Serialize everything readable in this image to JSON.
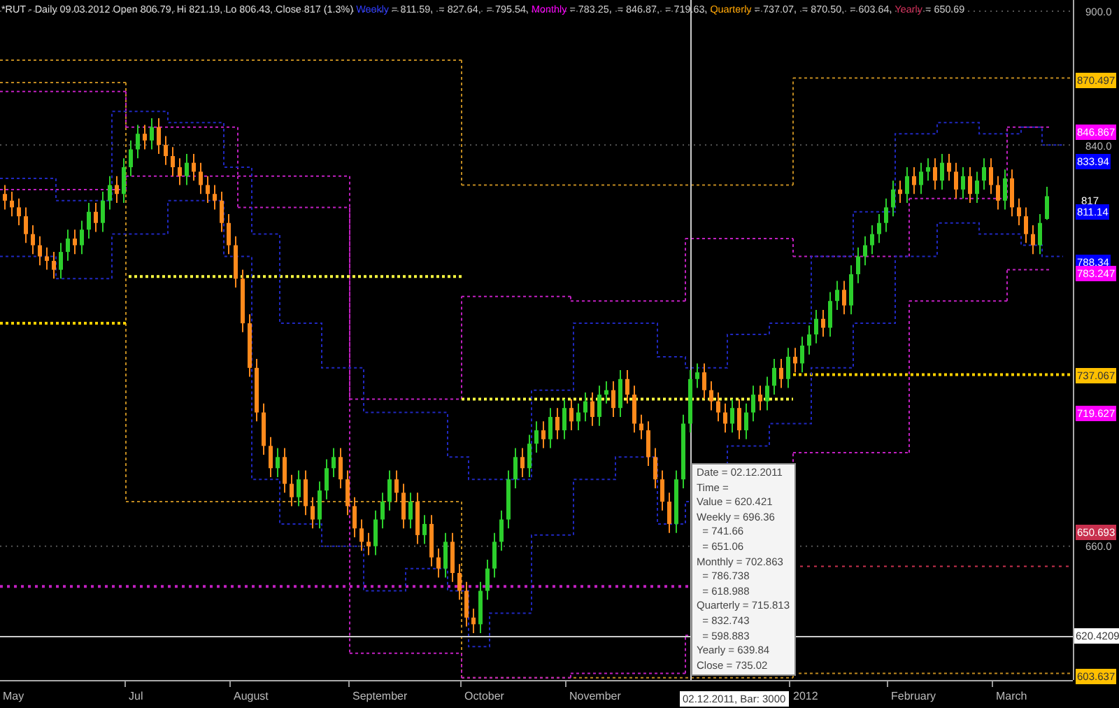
{
  "header": {
    "title": "*RUT - Daily 09.03.2012 Open 806.79, Hi 821.19, Lo 806.43, Close 817 (1.3%)",
    "series": [
      {
        "name": "Weekly",
        "color": "#2f3cff",
        "values": "= 811.59,  = 827.64,  = 795.54,"
      },
      {
        "name": "Monthly",
        "color": "#ff00ff",
        "values": "= 783.25,  = 846.87,  = 719.63,"
      },
      {
        "name": "Quarterly",
        "color": "#ffa500",
        "values": "= 737.07,  = 870.50,  = 603.64,"
      },
      {
        "name": "Yearly",
        "color": "#d0305a",
        "values": "= 650.69"
      }
    ]
  },
  "chart_data": {
    "type": "candlestick",
    "ylim": [
      600,
      905
    ],
    "grid": true,
    "yticks": [
      {
        "value": 900,
        "label": "900.0"
      },
      {
        "value": 840,
        "label": "840.0"
      },
      {
        "value": 660,
        "label": "660.0"
      }
    ],
    "ohlc": [
      [
        818,
        822,
        811,
        815
      ],
      [
        815,
        819,
        808,
        812
      ],
      [
        812,
        816,
        804,
        808
      ],
      [
        808,
        812,
        796,
        800
      ],
      [
        800,
        804,
        791,
        795
      ],
      [
        795,
        799,
        786,
        790
      ],
      [
        790,
        794,
        784,
        788
      ],
      [
        788,
        792,
        780,
        784
      ],
      [
        784,
        796,
        780,
        792
      ],
      [
        792,
        802,
        788,
        798
      ],
      [
        798,
        802,
        791,
        795
      ],
      [
        795,
        806,
        791,
        802
      ],
      [
        802,
        814,
        798,
        810
      ],
      [
        810,
        814,
        801,
        805
      ],
      [
        805,
        819,
        801,
        815
      ],
      [
        815,
        826,
        811,
        822
      ],
      [
        822,
        826,
        814,
        818
      ],
      [
        818,
        834,
        814,
        830
      ],
      [
        830,
        842,
        826,
        838
      ],
      [
        838,
        849,
        834,
        845
      ],
      [
        845,
        849,
        838,
        842
      ],
      [
        842,
        852,
        838,
        848
      ],
      [
        848,
        852,
        836,
        840
      ],
      [
        840,
        844,
        831,
        835
      ],
      [
        835,
        839,
        826,
        830
      ],
      [
        830,
        834,
        822,
        826
      ],
      [
        826,
        836,
        822,
        832
      ],
      [
        832,
        836,
        824,
        828
      ],
      [
        828,
        832,
        818,
        822
      ],
      [
        822,
        826,
        814,
        818
      ],
      [
        818,
        822,
        811,
        815
      ],
      [
        815,
        819,
        801,
        805
      ],
      [
        805,
        809,
        791,
        795
      ],
      [
        795,
        799,
        776,
        780
      ],
      [
        780,
        784,
        756,
        760
      ],
      [
        760,
        764,
        736,
        740
      ],
      [
        740,
        744,
        716,
        720
      ],
      [
        720,
        724,
        701,
        705
      ],
      [
        705,
        709,
        691,
        695
      ],
      [
        695,
        704,
        691,
        700
      ],
      [
        700,
        704,
        684,
        688
      ],
      [
        688,
        692,
        678,
        682
      ],
      [
        682,
        694,
        678,
        690
      ],
      [
        690,
        694,
        674,
        678
      ],
      [
        678,
        682,
        668,
        672
      ],
      [
        672,
        689,
        668,
        685
      ],
      [
        685,
        699,
        681,
        695
      ],
      [
        695,
        704,
        691,
        700
      ],
      [
        700,
        704,
        686,
        690
      ],
      [
        690,
        694,
        674,
        678
      ],
      [
        678,
        682,
        664,
        668
      ],
      [
        668,
        672,
        658,
        662
      ],
      [
        662,
        666,
        656,
        660
      ],
      [
        660,
        676,
        656,
        672
      ],
      [
        672,
        684,
        668,
        680
      ],
      [
        680,
        694,
        676,
        690
      ],
      [
        690,
        694,
        680,
        684
      ],
      [
        684,
        688,
        668,
        672
      ],
      [
        672,
        684,
        668,
        680
      ],
      [
        680,
        684,
        661,
        665
      ],
      [
        665,
        674,
        661,
        670
      ],
      [
        670,
        674,
        651,
        655
      ],
      [
        655,
        659,
        646,
        650
      ],
      [
        650,
        666,
        646,
        662
      ],
      [
        662,
        666,
        644,
        648
      ],
      [
        648,
        652,
        636,
        640
      ],
      [
        640,
        644,
        624,
        628
      ],
      [
        628,
        632,
        621,
        625
      ],
      [
        625,
        644,
        621,
        640
      ],
      [
        640,
        654,
        636,
        650
      ],
      [
        650,
        666,
        646,
        662
      ],
      [
        662,
        676,
        658,
        672
      ],
      [
        672,
        694,
        668,
        690
      ],
      [
        690,
        704,
        686,
        700
      ],
      [
        700,
        704,
        691,
        695
      ],
      [
        695,
        710,
        691,
        706
      ],
      [
        706,
        716,
        702,
        712
      ],
      [
        712,
        716,
        704,
        708
      ],
      [
        708,
        722,
        704,
        718
      ],
      [
        718,
        722,
        708,
        712
      ],
      [
        712,
        726,
        708,
        722
      ],
      [
        722,
        726,
        712,
        716
      ],
      [
        716,
        724,
        712,
        720
      ],
      [
        720,
        729,
        716,
        725
      ],
      [
        725,
        729,
        714,
        718
      ],
      [
        718,
        732,
        714,
        728
      ],
      [
        728,
        734,
        724,
        730
      ],
      [
        730,
        734,
        718,
        722
      ],
      [
        722,
        739,
        718,
        735
      ],
      [
        735,
        739,
        724,
        728
      ],
      [
        728,
        732,
        711,
        715
      ],
      [
        715,
        719,
        708,
        712
      ],
      [
        712,
        716,
        696,
        700
      ],
      [
        700,
        704,
        686,
        690
      ],
      [
        690,
        694,
        676,
        680
      ],
      [
        680,
        684,
        666,
        670
      ],
      [
        670,
        694,
        666,
        690
      ],
      [
        690,
        719,
        686,
        715
      ],
      [
        715,
        739,
        711,
        735
      ],
      [
        735,
        742,
        731,
        738
      ],
      [
        738,
        742,
        726,
        730
      ],
      [
        730,
        734,
        721,
        725
      ],
      [
        725,
        729,
        716,
        720
      ],
      [
        720,
        724,
        711,
        715
      ],
      [
        715,
        726,
        711,
        722
      ],
      [
        722,
        726,
        708,
        712
      ],
      [
        712,
        724,
        708,
        720
      ],
      [
        720,
        732,
        716,
        728
      ],
      [
        728,
        732,
        721,
        725
      ],
      [
        725,
        736,
        721,
        732
      ],
      [
        732,
        744,
        728,
        740
      ],
      [
        740,
        744,
        731,
        735
      ],
      [
        735,
        749,
        731,
        745
      ],
      [
        745,
        749,
        738,
        742
      ],
      [
        742,
        754,
        738,
        750
      ],
      [
        750,
        759,
        746,
        755
      ],
      [
        755,
        766,
        751,
        762
      ],
      [
        762,
        766,
        754,
        758
      ],
      [
        758,
        774,
        754,
        770
      ],
      [
        770,
        779,
        766,
        775
      ],
      [
        775,
        779,
        764,
        768
      ],
      [
        768,
        786,
        764,
        782
      ],
      [
        782,
        794,
        778,
        790
      ],
      [
        790,
        799,
        786,
        795
      ],
      [
        795,
        804,
        791,
        800
      ],
      [
        800,
        809,
        796,
        805
      ],
      [
        805,
        816,
        801,
        812
      ],
      [
        812,
        824,
        808,
        820
      ],
      [
        820,
        824,
        814,
        818
      ],
      [
        818,
        830,
        814,
        826
      ],
      [
        826,
        830,
        818,
        822
      ],
      [
        822,
        832,
        818,
        828
      ],
      [
        828,
        834,
        824,
        830
      ],
      [
        830,
        834,
        820,
        824
      ],
      [
        824,
        836,
        820,
        832
      ],
      [
        832,
        836,
        824,
        828
      ],
      [
        828,
        832,
        816,
        820
      ],
      [
        820,
        830,
        816,
        826
      ],
      [
        826,
        830,
        814,
        818
      ],
      [
        818,
        828,
        814,
        824
      ],
      [
        824,
        834,
        820,
        830
      ],
      [
        830,
        834,
        818,
        822
      ],
      [
        822,
        826,
        811,
        815
      ],
      [
        815,
        829,
        811,
        825
      ],
      [
        825,
        829,
        808,
        812
      ],
      [
        812,
        816,
        804,
        808
      ],
      [
        808,
        812,
        796,
        800
      ],
      [
        800,
        804,
        791,
        795
      ],
      [
        795,
        809,
        791,
        805
      ],
      [
        806.79,
        821.19,
        806.43,
        817
      ]
    ]
  },
  "price_axis": [
    {
      "kind": "level",
      "text": "870.497",
      "color": "#ffc000"
    },
    {
      "kind": "level",
      "text": "846.867",
      "color": "#ff00ff"
    },
    {
      "kind": "level",
      "text": "833.94",
      "color": "#0000ff"
    },
    {
      "kind": "label",
      "text": "817"
    },
    {
      "kind": "current",
      "text": "811.14",
      "color": "#0000ff"
    },
    {
      "kind": "level",
      "text": "788.34",
      "color": "#0000ff"
    },
    {
      "kind": "level",
      "text": "783.247",
      "color": "#ff00ff"
    },
    {
      "kind": "level",
      "text": "737.067",
      "color": "#ffc000"
    },
    {
      "kind": "level",
      "text": "719.627",
      "color": "#ff00ff"
    },
    {
      "kind": "level",
      "text": "650.693",
      "color": "#c8304e"
    },
    {
      "kind": "crosshair",
      "text": "620.4209"
    },
    {
      "kind": "level",
      "text": "603.637",
      "color": "#ffc000"
    }
  ],
  "time_axis": [
    "May",
    "Jul",
    "August",
    "September",
    "October",
    "November",
    "2012",
    "February",
    "March"
  ],
  "crosshair_label": "02.12.2011, Bar: 3000",
  "tooltip": [
    "Date = 02.12.2011",
    "Time =",
    "Value = 620.421",
    "Weekly = 696.36",
    "  = 741.66",
    "  = 651.06",
    "Monthly = 702.863",
    "  = 786.738",
    "  = 618.988",
    "Quarterly = 715.813",
    "  = 832.743",
    "  = 598.883",
    "Yearly = 639.84",
    "Close = 735.02"
  ]
}
